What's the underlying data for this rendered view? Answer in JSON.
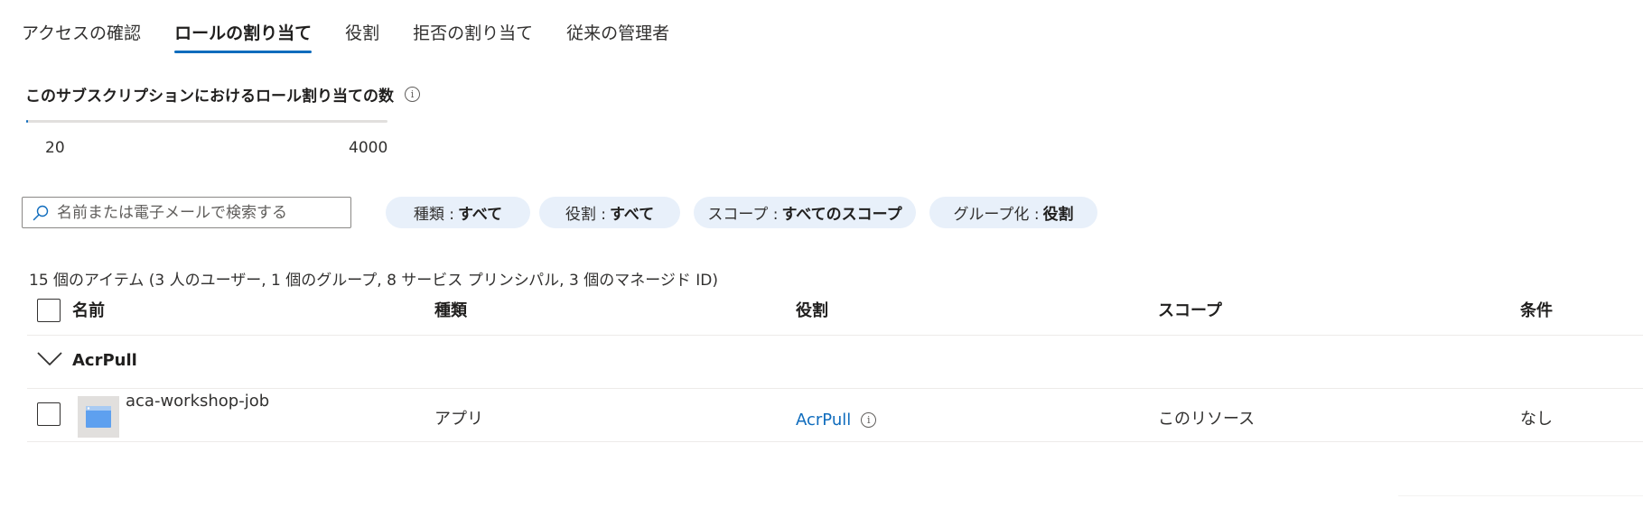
{
  "tabs": [
    {
      "label": "アクセスの確認",
      "active": false
    },
    {
      "label": "ロールの割り当て",
      "active": true
    },
    {
      "label": "役割",
      "active": false
    },
    {
      "label": "拒否の割り当て",
      "active": false
    },
    {
      "label": "従来の管理者",
      "active": false
    }
  ],
  "assignment_count": {
    "title": "このサブスクリプションにおけるロール割り当ての数",
    "info_icon": "info-icon",
    "current": "20",
    "max": "4000",
    "progress_fraction": 0.005
  },
  "search": {
    "placeholder": "名前または電子メールで検索する",
    "value": ""
  },
  "filters": [
    {
      "label": "種類 :",
      "value": "すべて"
    },
    {
      "label": "役割 :",
      "value": "すべて"
    },
    {
      "label": "スコープ :",
      "value": "すべてのスコープ"
    },
    {
      "label": "グループ化 :",
      "value": "役割"
    }
  ],
  "summary": "15 個のアイテム (3 人のユーザー, 1 個のグループ, 8 サービス プリンシパル, 3 個のマネージド ID)",
  "table": {
    "columns": [
      "名前",
      "種類",
      "役割",
      "スコープ",
      "条件"
    ],
    "groups": [
      {
        "label": "AcrPull",
        "expanded": true,
        "rows": [
          {
            "name": "aca-workshop-job",
            "type": "アプリ",
            "role": "AcrPull",
            "scope": "このリソース",
            "condition": "なし"
          }
        ]
      }
    ]
  },
  "colors": {
    "accent": "#0f6cbd",
    "pill_bg": "#e8f0fa",
    "border": "#edebe9"
  }
}
